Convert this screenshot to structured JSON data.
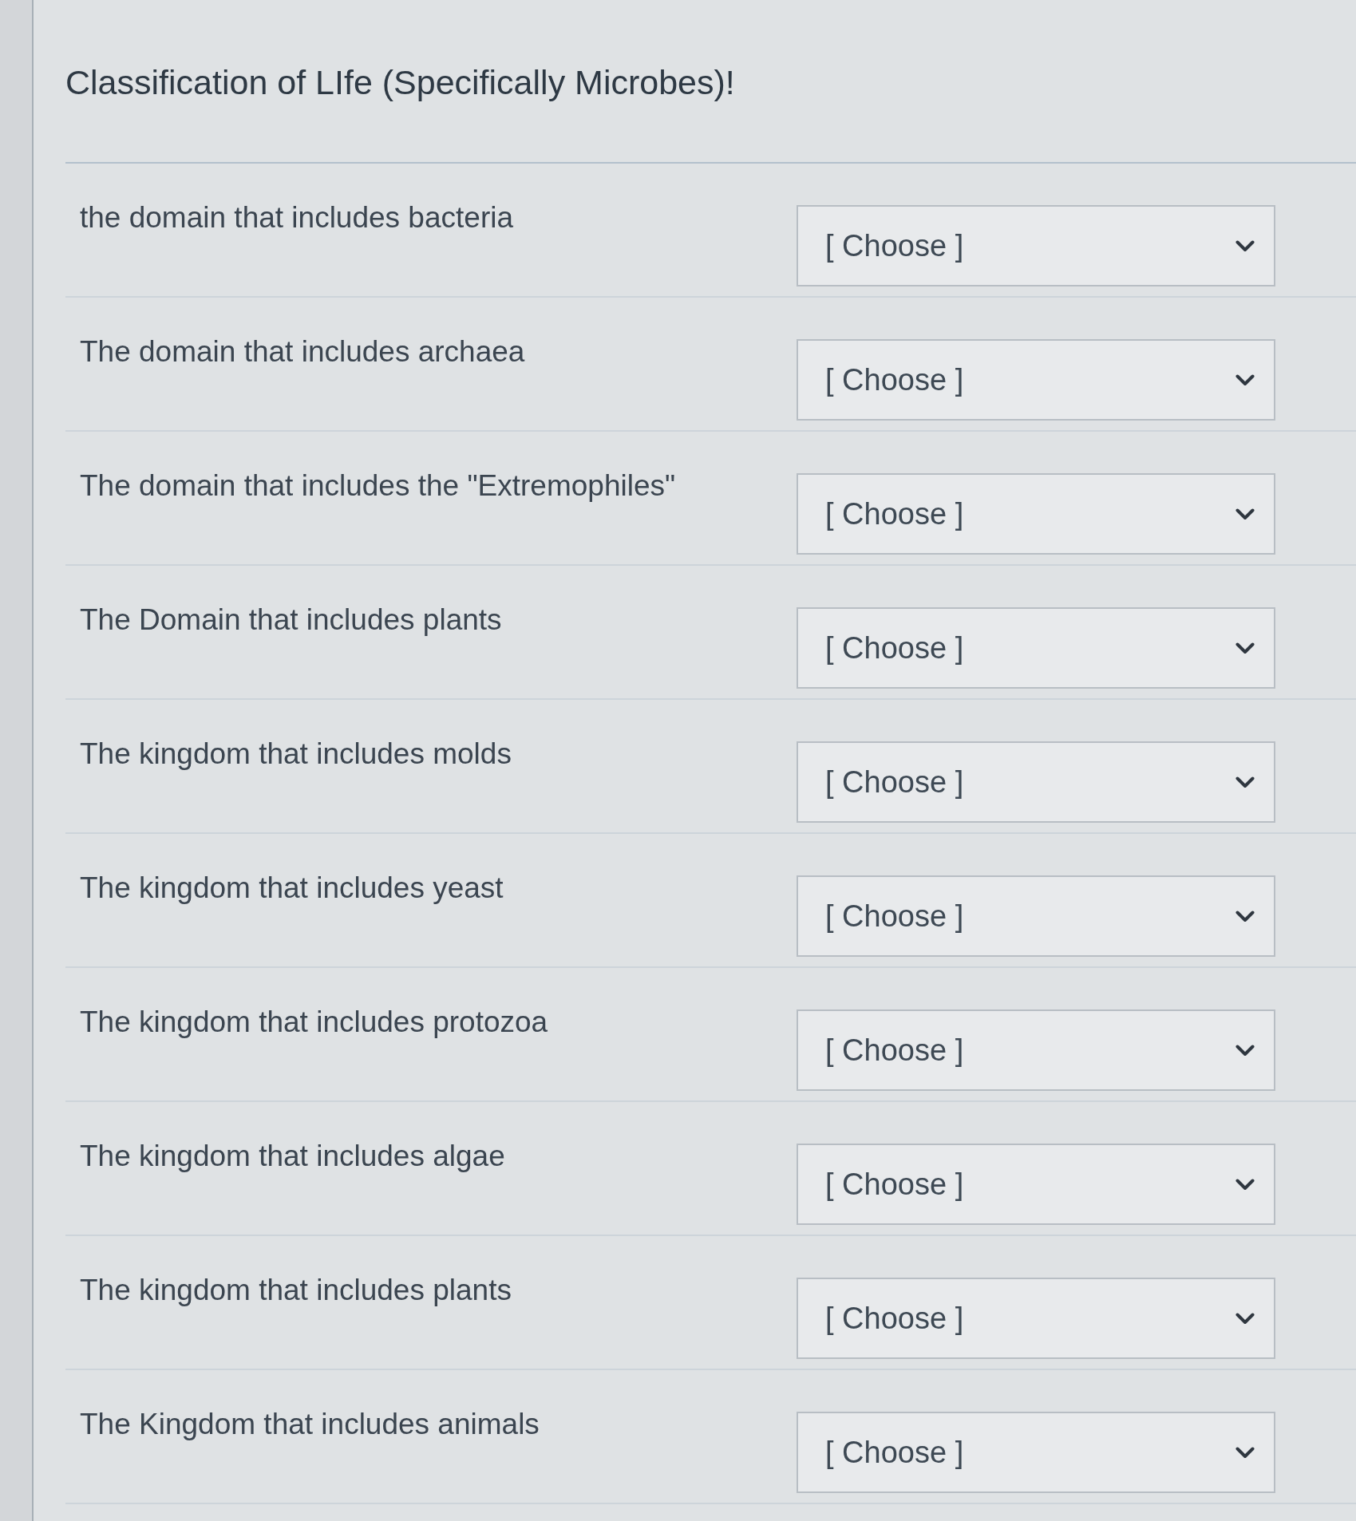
{
  "title": "Classification of LIfe (Specifically Microbes)!",
  "questions": [
    {
      "prompt": "the domain that includes bacteria",
      "answer": {
        "value": "[ Choose ]"
      }
    },
    {
      "prompt": "The domain that includes archaea",
      "answer": {
        "value": "[ Choose ]"
      }
    },
    {
      "prompt": "The domain that includes the \"Extremophiles\"",
      "answer": {
        "value": "[ Choose ]"
      }
    },
    {
      "prompt": "The Domain that includes plants",
      "answer": {
        "value": "[ Choose ]"
      }
    },
    {
      "prompt": "The kingdom that includes molds",
      "answer": {
        "value": "[ Choose ]"
      }
    },
    {
      "prompt": "The kingdom that includes yeast",
      "answer": {
        "value": "[ Choose ]"
      }
    },
    {
      "prompt": "The kingdom that includes protozoa",
      "answer": {
        "value": "[ Choose ]"
      }
    },
    {
      "prompt": "The kingdom that includes algae",
      "answer": {
        "value": "[ Choose ]"
      }
    },
    {
      "prompt": "The kingdom that includes plants",
      "answer": {
        "value": "[ Choose ]"
      }
    },
    {
      "prompt": "The Kingdom that includes animals",
      "answer": {
        "value": "[ Choose ]"
      }
    }
  ]
}
